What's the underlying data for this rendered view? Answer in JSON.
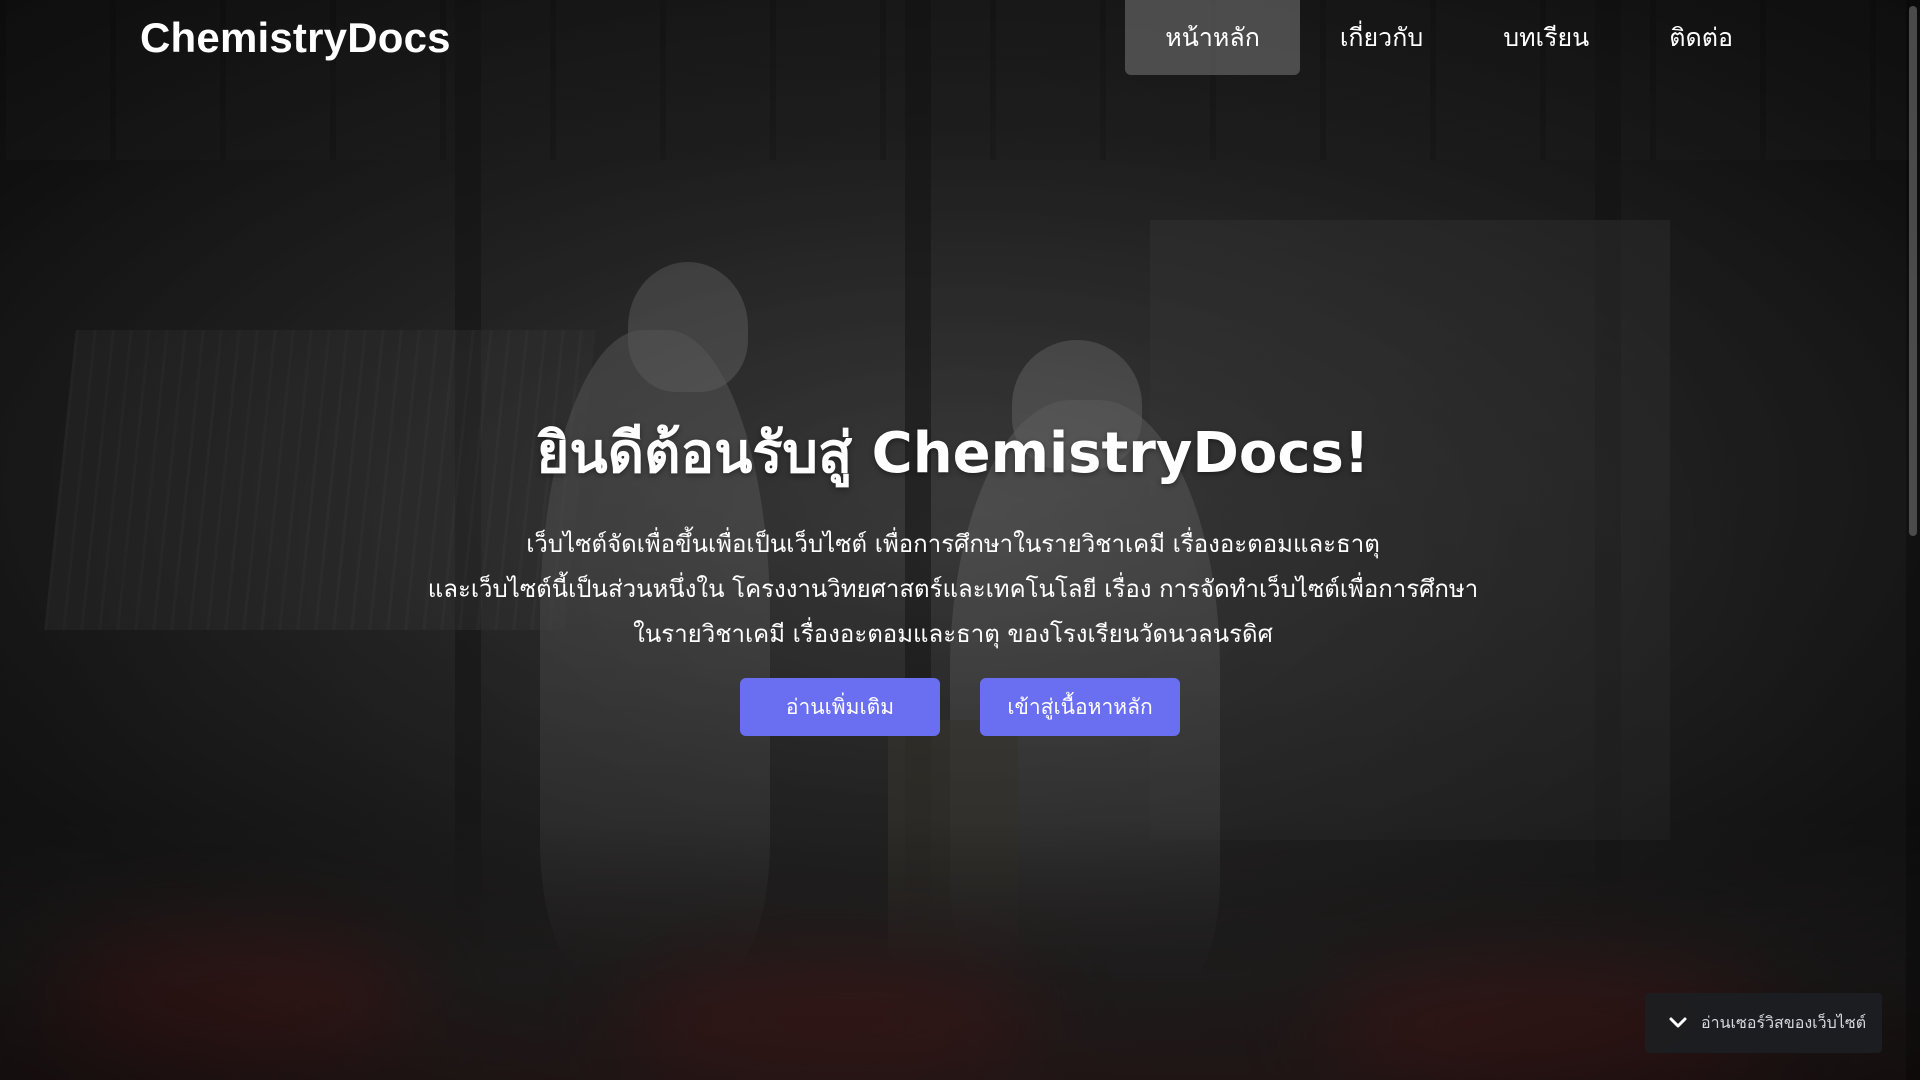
{
  "header": {
    "logo": "ChemistryDocs",
    "nav": [
      {
        "label": "หน้าหลัก",
        "active": true
      },
      {
        "label": "เกี่ยวกับ",
        "active": false
      },
      {
        "label": "บทเรียน",
        "active": false
      },
      {
        "label": "ติดต่อ",
        "active": false
      }
    ]
  },
  "hero": {
    "title": "ยินดีต้อนรับสู่ ChemistryDocs!",
    "description": [
      "เว็บไซต์จัดเพื่อขึ้นเพื่อเป็นเว็บไซต์ เพื่อการศึกษาในรายวิชาเคมี เรื่องอะตอมและธาตุ",
      "และเว็บไซต์นี้เป็นส่วนหนึ่งใน โครงงานวิทยศาสตร์และเทคโนโลยี เรื่อง การจัดทำเว็บไซต์เพื่อการศึกษา",
      "ในรายวิชาเคมี เรื่องอะตอมและธาตุ ของโรงเรียนวัดนวลนรดิศ"
    ],
    "buttons": {
      "read_more": "อ่านเพิ่มเติม",
      "enter_content": "เข้าสู่เนื้อหาหลัก"
    }
  },
  "read_service": {
    "label": "อ่านเซอร์วิสของเว็บไซต์",
    "icon": "chevron-down-icon"
  },
  "colors": {
    "button": "#6a6ff2",
    "nav_active_bg": "#787878"
  }
}
